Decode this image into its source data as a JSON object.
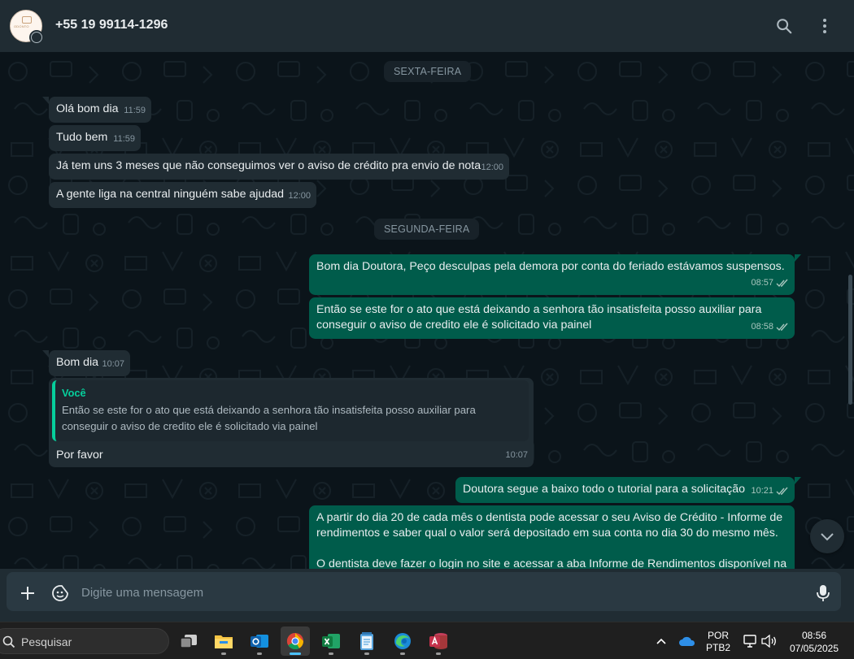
{
  "header": {
    "contact_name": "+55 19 99114-1296",
    "avatar_text": "ODONTO"
  },
  "days": [
    {
      "label": "SEXTA-FEIRA"
    },
    {
      "label": "SEGUNDA-FEIRA"
    }
  ],
  "messages": [
    {
      "dir": "in",
      "text": "Olá bom dia",
      "time": "11:59"
    },
    {
      "dir": "in",
      "text": "Tudo bem",
      "time": "11:59"
    },
    {
      "dir": "in",
      "text": "Já tem uns 3 meses que não conseguimos ver o aviso de crédito pra envio de nota",
      "time": "12:00"
    },
    {
      "dir": "in",
      "text": "A gente liga na central ninguém sabe ajudad",
      "time": "12:00"
    },
    {
      "dir": "out",
      "text": "Bom dia Doutora, Peço desculpas pela demora por conta do feriado estávamos suspensos.",
      "time": "08:57"
    },
    {
      "dir": "out",
      "text": "Então se este for o ato que está deixando a senhora tão insatisfeita posso auxiliar para conseguir o aviso de credito ele é solicitado via painel",
      "time": "08:58"
    },
    {
      "dir": "in",
      "text": "Bom dia",
      "time": "10:07"
    },
    {
      "dir": "in",
      "text": "Por favor",
      "time": "10:07",
      "quote": {
        "author": "Você",
        "text": "Então se este for o ato que está deixando a senhora tão insatisfeita posso auxiliar para conseguir o aviso de credito ele é solicitado via painel"
      }
    },
    {
      "dir": "out",
      "text": "Doutora segue a baixo todo o tutorial para a solicitação",
      "time": "10:21"
    },
    {
      "dir": "out",
      "text": "A partir do dia 20 de cada mês o dentista pode acessar o seu Aviso de Crédito - Informe de rendimentos e saber qual o valor será depositado em sua conta no dia 30 do mesmo mês.",
      "text2": "O dentista deve fazer o login no site e acessar a aba Informe de Rendimentos disponível na"
    }
  ],
  "composer": {
    "placeholder": "Digite uma mensagem"
  },
  "taskbar": {
    "search_label": "Pesquisar",
    "lang_top": "POR",
    "lang_bottom": "PTB2",
    "clock_time": "08:56",
    "clock_date": "07/05/2025"
  },
  "colors": {
    "background": "#0b141a",
    "panel": "#202c33",
    "incoming": "#202c33",
    "outgoing": "#005c4b",
    "accent": "#06cf9c"
  }
}
